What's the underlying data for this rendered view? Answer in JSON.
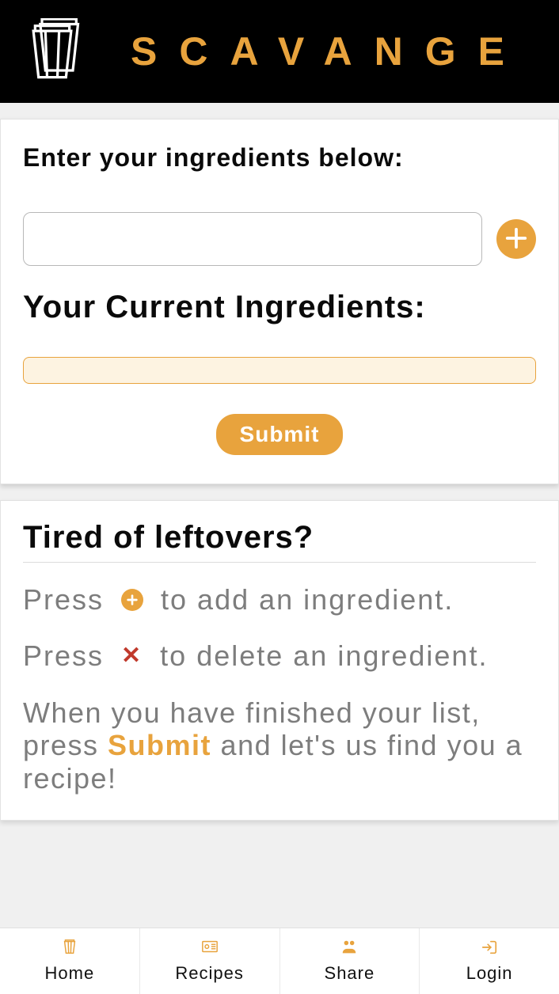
{
  "header": {
    "brand": "SCAVANGE"
  },
  "panel1": {
    "enter_label": "Enter your ingredients below:",
    "input_value": "",
    "input_placeholder": "",
    "current_label": "Your Current Ingredients:",
    "ingredients": [],
    "submit_label": "Submit"
  },
  "panel2": {
    "title": "Tired of leftovers?",
    "line1_pre": "Press",
    "line1_post": "to add an ingredient.",
    "line2_pre": "Press",
    "line2_post": "to delete an ingredient.",
    "para_pre": "When you have finished your list, press ",
    "para_highlight": "Submit",
    "para_post": " and let's us find you a recipe!"
  },
  "nav": {
    "home": "Home",
    "recipes": "Recipes",
    "share": "Share",
    "login": "Login"
  },
  "colors": {
    "accent": "#e8a33d",
    "danger": "#c0392b"
  }
}
